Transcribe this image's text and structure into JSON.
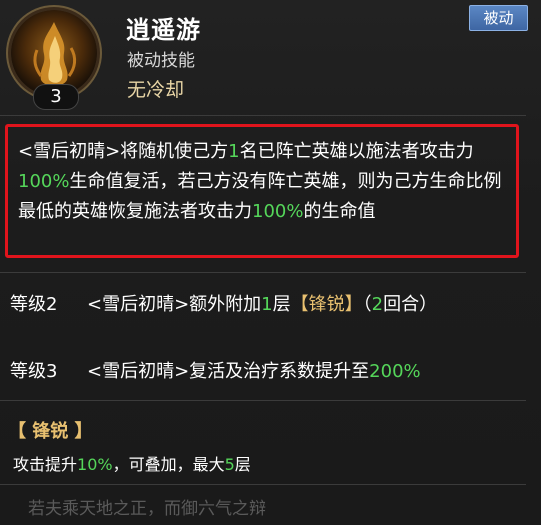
{
  "header": {
    "skill_name": "逍遥游",
    "skill_type": "被动技能",
    "cooldown": "无冷却",
    "level": "3",
    "tag": "被动",
    "icon": "flame-skill-icon"
  },
  "description": {
    "p1": "<雪后初晴>将随机使己方",
    "n1": "1",
    "p2": "名已阵亡英雄以施法者攻击力",
    "n2": "100%",
    "p3": "生命值复活，若己方没有阵亡英雄，则为己方生命比例最低的英雄恢复施法者攻击力",
    "n3": "100%",
    "p4": "的生命值"
  },
  "levels": [
    {
      "label": "等级2",
      "a": "<雪后初晴>额外附加",
      "n1": "1",
      "b": "层",
      "kw": "【锋锐】",
      "c": "（",
      "n2": "2",
      "d": "回合）"
    },
    {
      "label": "等级3",
      "a": "<雪后初晴>复活及治疗系数提升至",
      "n1": "200%"
    }
  ],
  "keyword": {
    "title": "【 锋锐 】",
    "a": "攻击提升",
    "n1": "10%",
    "b": "，可叠加，最大",
    "n2": "5",
    "c": "层"
  },
  "quote": "若夫乘天地之正，而御六气之辩",
  "colors": {
    "highlight_green": "#55d65a",
    "keyword_gold": "#e8c070",
    "frame_red": "#e0141c",
    "tag_blue": "#4a74b4"
  }
}
